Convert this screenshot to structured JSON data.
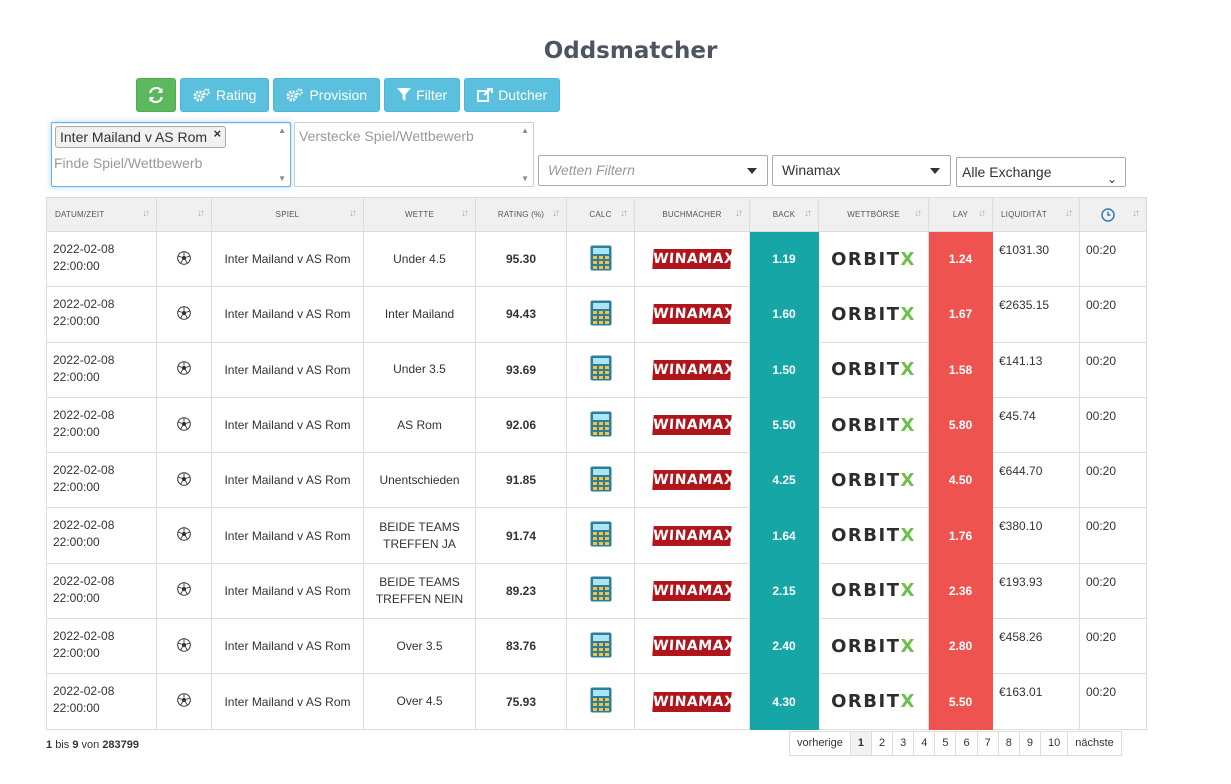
{
  "page": {
    "title": "Oddsmatcher"
  },
  "toolbar": {
    "refresh_icon": "refresh-icon",
    "rating_label": "Rating",
    "provision_label": "Provision",
    "filter_label": "Filter",
    "dutcher_label": "Dutcher"
  },
  "filters": {
    "game_tag": "Inter Mailand v AS Rom",
    "game_placeholder": "Finde Spiel/Wettbewerb",
    "hide_placeholder": "Verstecke Spiel/Wettbewerb",
    "bet_filter_placeholder": "Wetten Filtern",
    "bookmaker_value": "Winamax",
    "exchange_value": "Alle Exchange"
  },
  "table": {
    "headers": {
      "date": "DATUM/ZEIT",
      "game": "SPIEL",
      "bet": "WETTE",
      "rating": "RATING (%)",
      "calc": "CALC",
      "bookmaker": "BUCHMACHER",
      "back": "BACK",
      "exchange": "WETTBÖRSE",
      "lay": "LAY",
      "liquidity": "LIQUIDITÄT"
    },
    "rows": [
      {
        "date": "2022-02-08",
        "time": "22:00:00",
        "game": "Inter Mailand v AS Rom",
        "bet": "Under 4.5",
        "rating": "95.30",
        "bookmaker": "WINAMAX",
        "back": "1.19",
        "exchange": "ORBITX",
        "lay": "1.24",
        "liquidity": "€1031.30",
        "updated": "00:20"
      },
      {
        "date": "2022-02-08",
        "time": "22:00:00",
        "game": "Inter Mailand v AS Rom",
        "bet": "Inter Mailand",
        "rating": "94.43",
        "bookmaker": "WINAMAX",
        "back": "1.60",
        "exchange": "ORBITX",
        "lay": "1.67",
        "liquidity": "€2635.15",
        "updated": "00:20"
      },
      {
        "date": "2022-02-08",
        "time": "22:00:00",
        "game": "Inter Mailand v AS Rom",
        "bet": "Under 3.5",
        "rating": "93.69",
        "bookmaker": "WINAMAX",
        "back": "1.50",
        "exchange": "ORBITX",
        "lay": "1.58",
        "liquidity": "€141.13",
        "updated": "00:20"
      },
      {
        "date": "2022-02-08",
        "time": "22:00:00",
        "game": "Inter Mailand v AS Rom",
        "bet": "AS Rom",
        "rating": "92.06",
        "bookmaker": "WINAMAX",
        "back": "5.50",
        "exchange": "ORBITX",
        "lay": "5.80",
        "liquidity": "€45.74",
        "updated": "00:20"
      },
      {
        "date": "2022-02-08",
        "time": "22:00:00",
        "game": "Inter Mailand v AS Rom",
        "bet": "Unentschieden",
        "rating": "91.85",
        "bookmaker": "WINAMAX",
        "back": "4.25",
        "exchange": "ORBITX",
        "lay": "4.50",
        "liquidity": "€644.70",
        "updated": "00:20"
      },
      {
        "date": "2022-02-08",
        "time": "22:00:00",
        "game": "Inter Mailand v AS Rom",
        "bet": "BEIDE TEAMS TREFFEN JA",
        "rating": "91.74",
        "bookmaker": "WINAMAX",
        "back": "1.64",
        "exchange": "ORBITX",
        "lay": "1.76",
        "liquidity": "€380.10",
        "updated": "00:20"
      },
      {
        "date": "2022-02-08",
        "time": "22:00:00",
        "game": "Inter Mailand v AS Rom",
        "bet": "BEIDE TEAMS TREFFEN NEIN",
        "rating": "89.23",
        "bookmaker": "WINAMAX",
        "back": "2.15",
        "exchange": "ORBITX",
        "lay": "2.36",
        "liquidity": "€193.93",
        "updated": "00:20"
      },
      {
        "date": "2022-02-08",
        "time": "22:00:00",
        "game": "Inter Mailand v AS Rom",
        "bet": "Over 3.5",
        "rating": "83.76",
        "bookmaker": "WINAMAX",
        "back": "2.40",
        "exchange": "ORBITX",
        "lay": "2.80",
        "liquidity": "€458.26",
        "updated": "00:20"
      },
      {
        "date": "2022-02-08",
        "time": "22:00:00",
        "game": "Inter Mailand v AS Rom",
        "bet": "Over 4.5",
        "rating": "75.93",
        "bookmaker": "WINAMAX",
        "back": "4.30",
        "exchange": "ORBITX",
        "lay": "5.50",
        "liquidity": "€163.01",
        "updated": "00:20"
      }
    ]
  },
  "footer": {
    "info_from": "1",
    "info_bis": "bis",
    "info_to": "9",
    "info_von": "von",
    "info_total": "283799",
    "prev_label": "vorherige",
    "next_label": "nächste",
    "pages": [
      "1",
      "2",
      "3",
      "4",
      "5",
      "6",
      "7",
      "8",
      "9",
      "10"
    ],
    "active_page": "1"
  },
  "colors": {
    "back": "#17a6a6",
    "lay": "#ef5350",
    "refresh_button": "#5cb85c",
    "info_button": "#5bc0de",
    "winamax": "#b0151b",
    "orbitx_accent": "#6cc04a"
  }
}
